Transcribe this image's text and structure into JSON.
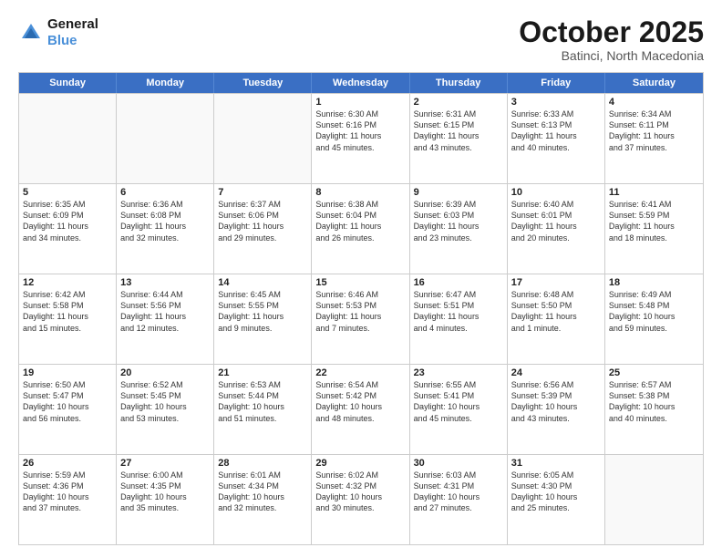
{
  "header": {
    "logo_line1": "General",
    "logo_line2": "Blue",
    "month": "October 2025",
    "location": "Batinci, North Macedonia"
  },
  "weekdays": [
    "Sunday",
    "Monday",
    "Tuesday",
    "Wednesday",
    "Thursday",
    "Friday",
    "Saturday"
  ],
  "rows": [
    [
      {
        "day": "",
        "text": "",
        "empty": true
      },
      {
        "day": "",
        "text": "",
        "empty": true
      },
      {
        "day": "",
        "text": "",
        "empty": true
      },
      {
        "day": "1",
        "text": "Sunrise: 6:30 AM\nSunset: 6:16 PM\nDaylight: 11 hours\nand 45 minutes."
      },
      {
        "day": "2",
        "text": "Sunrise: 6:31 AM\nSunset: 6:15 PM\nDaylight: 11 hours\nand 43 minutes."
      },
      {
        "day": "3",
        "text": "Sunrise: 6:33 AM\nSunset: 6:13 PM\nDaylight: 11 hours\nand 40 minutes."
      },
      {
        "day": "4",
        "text": "Sunrise: 6:34 AM\nSunset: 6:11 PM\nDaylight: 11 hours\nand 37 minutes."
      }
    ],
    [
      {
        "day": "5",
        "text": "Sunrise: 6:35 AM\nSunset: 6:09 PM\nDaylight: 11 hours\nand 34 minutes."
      },
      {
        "day": "6",
        "text": "Sunrise: 6:36 AM\nSunset: 6:08 PM\nDaylight: 11 hours\nand 32 minutes."
      },
      {
        "day": "7",
        "text": "Sunrise: 6:37 AM\nSunset: 6:06 PM\nDaylight: 11 hours\nand 29 minutes."
      },
      {
        "day": "8",
        "text": "Sunrise: 6:38 AM\nSunset: 6:04 PM\nDaylight: 11 hours\nand 26 minutes."
      },
      {
        "day": "9",
        "text": "Sunrise: 6:39 AM\nSunset: 6:03 PM\nDaylight: 11 hours\nand 23 minutes."
      },
      {
        "day": "10",
        "text": "Sunrise: 6:40 AM\nSunset: 6:01 PM\nDaylight: 11 hours\nand 20 minutes."
      },
      {
        "day": "11",
        "text": "Sunrise: 6:41 AM\nSunset: 5:59 PM\nDaylight: 11 hours\nand 18 minutes."
      }
    ],
    [
      {
        "day": "12",
        "text": "Sunrise: 6:42 AM\nSunset: 5:58 PM\nDaylight: 11 hours\nand 15 minutes."
      },
      {
        "day": "13",
        "text": "Sunrise: 6:44 AM\nSunset: 5:56 PM\nDaylight: 11 hours\nand 12 minutes."
      },
      {
        "day": "14",
        "text": "Sunrise: 6:45 AM\nSunset: 5:55 PM\nDaylight: 11 hours\nand 9 minutes."
      },
      {
        "day": "15",
        "text": "Sunrise: 6:46 AM\nSunset: 5:53 PM\nDaylight: 11 hours\nand 7 minutes."
      },
      {
        "day": "16",
        "text": "Sunrise: 6:47 AM\nSunset: 5:51 PM\nDaylight: 11 hours\nand 4 minutes."
      },
      {
        "day": "17",
        "text": "Sunrise: 6:48 AM\nSunset: 5:50 PM\nDaylight: 11 hours\nand 1 minute."
      },
      {
        "day": "18",
        "text": "Sunrise: 6:49 AM\nSunset: 5:48 PM\nDaylight: 10 hours\nand 59 minutes."
      }
    ],
    [
      {
        "day": "19",
        "text": "Sunrise: 6:50 AM\nSunset: 5:47 PM\nDaylight: 10 hours\nand 56 minutes."
      },
      {
        "day": "20",
        "text": "Sunrise: 6:52 AM\nSunset: 5:45 PM\nDaylight: 10 hours\nand 53 minutes."
      },
      {
        "day": "21",
        "text": "Sunrise: 6:53 AM\nSunset: 5:44 PM\nDaylight: 10 hours\nand 51 minutes."
      },
      {
        "day": "22",
        "text": "Sunrise: 6:54 AM\nSunset: 5:42 PM\nDaylight: 10 hours\nand 48 minutes."
      },
      {
        "day": "23",
        "text": "Sunrise: 6:55 AM\nSunset: 5:41 PM\nDaylight: 10 hours\nand 45 minutes."
      },
      {
        "day": "24",
        "text": "Sunrise: 6:56 AM\nSunset: 5:39 PM\nDaylight: 10 hours\nand 43 minutes."
      },
      {
        "day": "25",
        "text": "Sunrise: 6:57 AM\nSunset: 5:38 PM\nDaylight: 10 hours\nand 40 minutes."
      }
    ],
    [
      {
        "day": "26",
        "text": "Sunrise: 5:59 AM\nSunset: 4:36 PM\nDaylight: 10 hours\nand 37 minutes."
      },
      {
        "day": "27",
        "text": "Sunrise: 6:00 AM\nSunset: 4:35 PM\nDaylight: 10 hours\nand 35 minutes."
      },
      {
        "day": "28",
        "text": "Sunrise: 6:01 AM\nSunset: 4:34 PM\nDaylight: 10 hours\nand 32 minutes."
      },
      {
        "day": "29",
        "text": "Sunrise: 6:02 AM\nSunset: 4:32 PM\nDaylight: 10 hours\nand 30 minutes."
      },
      {
        "day": "30",
        "text": "Sunrise: 6:03 AM\nSunset: 4:31 PM\nDaylight: 10 hours\nand 27 minutes."
      },
      {
        "day": "31",
        "text": "Sunrise: 6:05 AM\nSunset: 4:30 PM\nDaylight: 10 hours\nand 25 minutes."
      },
      {
        "day": "",
        "text": "",
        "empty": true
      }
    ]
  ]
}
